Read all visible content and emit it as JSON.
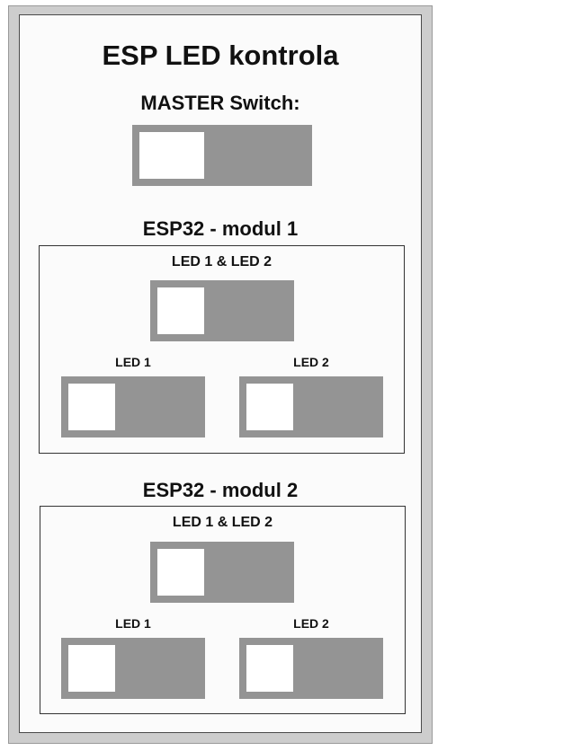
{
  "page": {
    "title": "ESP LED kontrola"
  },
  "master": {
    "label": "MASTER Switch:",
    "state": "off"
  },
  "modules": [
    {
      "heading": "ESP32 - modul 1",
      "combined": {
        "label": "LED 1 & LED 2",
        "state": "off"
      },
      "led1": {
        "label": "LED 1",
        "state": "off"
      },
      "led2": {
        "label": "LED 2",
        "state": "off"
      }
    },
    {
      "heading": "ESP32 - modul 2",
      "combined": {
        "label": "LED 1 & LED 2",
        "state": "off"
      },
      "led1": {
        "label": "LED 1",
        "state": "off"
      },
      "led2": {
        "label": "LED 2",
        "state": "off"
      }
    }
  ],
  "colors": {
    "switch_track": "#949494",
    "switch_knob": "#ffffff",
    "panel_background": "#fbfbfb",
    "outer_frame": "#cdcdcd"
  }
}
